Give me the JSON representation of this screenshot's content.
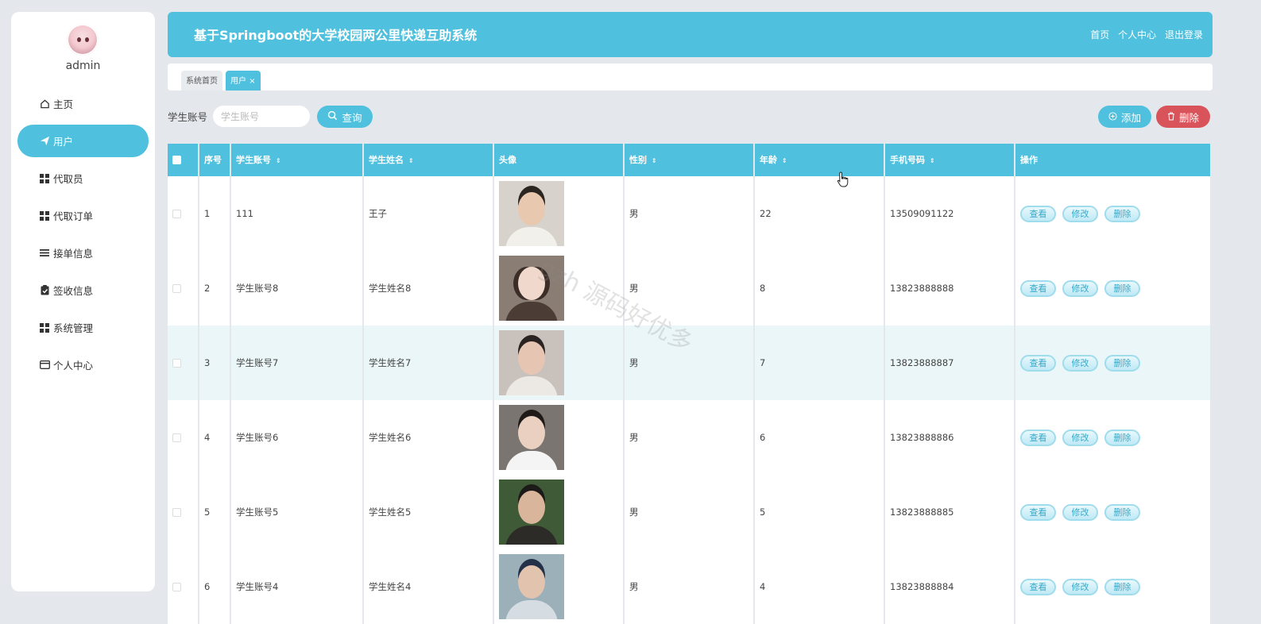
{
  "sidebar": {
    "username": "admin",
    "items": [
      {
        "label": "主页",
        "icon": "home-icon"
      },
      {
        "label": "用户",
        "icon": "send-icon",
        "active": true
      },
      {
        "label": "代取员",
        "icon": "grid-icon"
      },
      {
        "label": "代取订单",
        "icon": "grid-icon"
      },
      {
        "label": "接单信息",
        "icon": "list-icon"
      },
      {
        "label": "签收信息",
        "icon": "clipboard-check-icon"
      },
      {
        "label": "系统管理",
        "icon": "grid-icon"
      },
      {
        "label": "个人中心",
        "icon": "card-icon"
      }
    ]
  },
  "header": {
    "title": "基于Springboot的大学校园两公里快递互助系统",
    "links": [
      "首页",
      "个人中心",
      "退出登录"
    ]
  },
  "tabs": {
    "home": "系统首页",
    "current": "用户"
  },
  "search": {
    "label": "学生账号",
    "placeholder": "学生账号",
    "button": "查询"
  },
  "actions": {
    "add": "添加",
    "delete": "删除"
  },
  "table": {
    "columns": [
      "序号",
      "学生账号",
      "学生姓名",
      "头像",
      "性别",
      "年龄",
      "手机号码",
      "操作"
    ],
    "row_actions": {
      "view": "查看",
      "edit": "修改",
      "delete": "删除"
    },
    "rows": [
      {
        "index": "1",
        "account": "111",
        "name": "王子",
        "gender": "男",
        "age": "22",
        "phone": "13509091122"
      },
      {
        "index": "2",
        "account": "学生账号8",
        "name": "学生姓名8",
        "gender": "男",
        "age": "8",
        "phone": "13823888888"
      },
      {
        "index": "3",
        "account": "学生账号7",
        "name": "学生姓名7",
        "gender": "男",
        "age": "7",
        "phone": "13823888887"
      },
      {
        "index": "4",
        "account": "学生账号6",
        "name": "学生姓名6",
        "gender": "男",
        "age": "6",
        "phone": "13823888886"
      },
      {
        "index": "5",
        "account": "学生账号5",
        "name": "学生姓名5",
        "gender": "男",
        "age": "5",
        "phone": "13823888885"
      },
      {
        "index": "6",
        "account": "学生账号4",
        "name": "学生姓名4",
        "gender": "男",
        "age": "4",
        "phone": "13823888884"
      }
    ]
  },
  "watermark": "gzh 源码好优多",
  "colors": {
    "accent": "#4fc0dd",
    "danger": "#d9535a",
    "background": "#e4e8ec"
  }
}
